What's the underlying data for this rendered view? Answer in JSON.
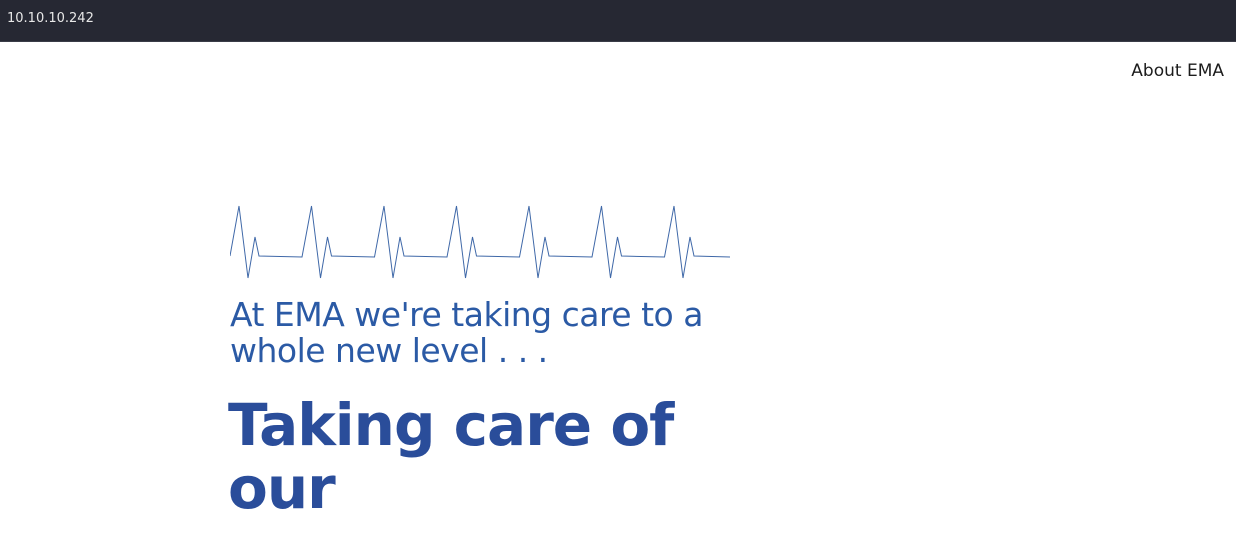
{
  "window": {
    "title": "10.10.10.242"
  },
  "nav": {
    "about_label": "About EMA"
  },
  "hero": {
    "tagline": "At EMA we're taking care to a whole new level . . .",
    "headline": "Taking care of our"
  },
  "colors": {
    "titlebar": "#262833",
    "tagline": "#2b5aa5",
    "headline": "#2a4d9a",
    "heartbeat_line": "#3f68a8",
    "nav_text": "#1c1c1c"
  },
  "icons": {
    "heartbeat": "heartbeat-line-icon"
  }
}
